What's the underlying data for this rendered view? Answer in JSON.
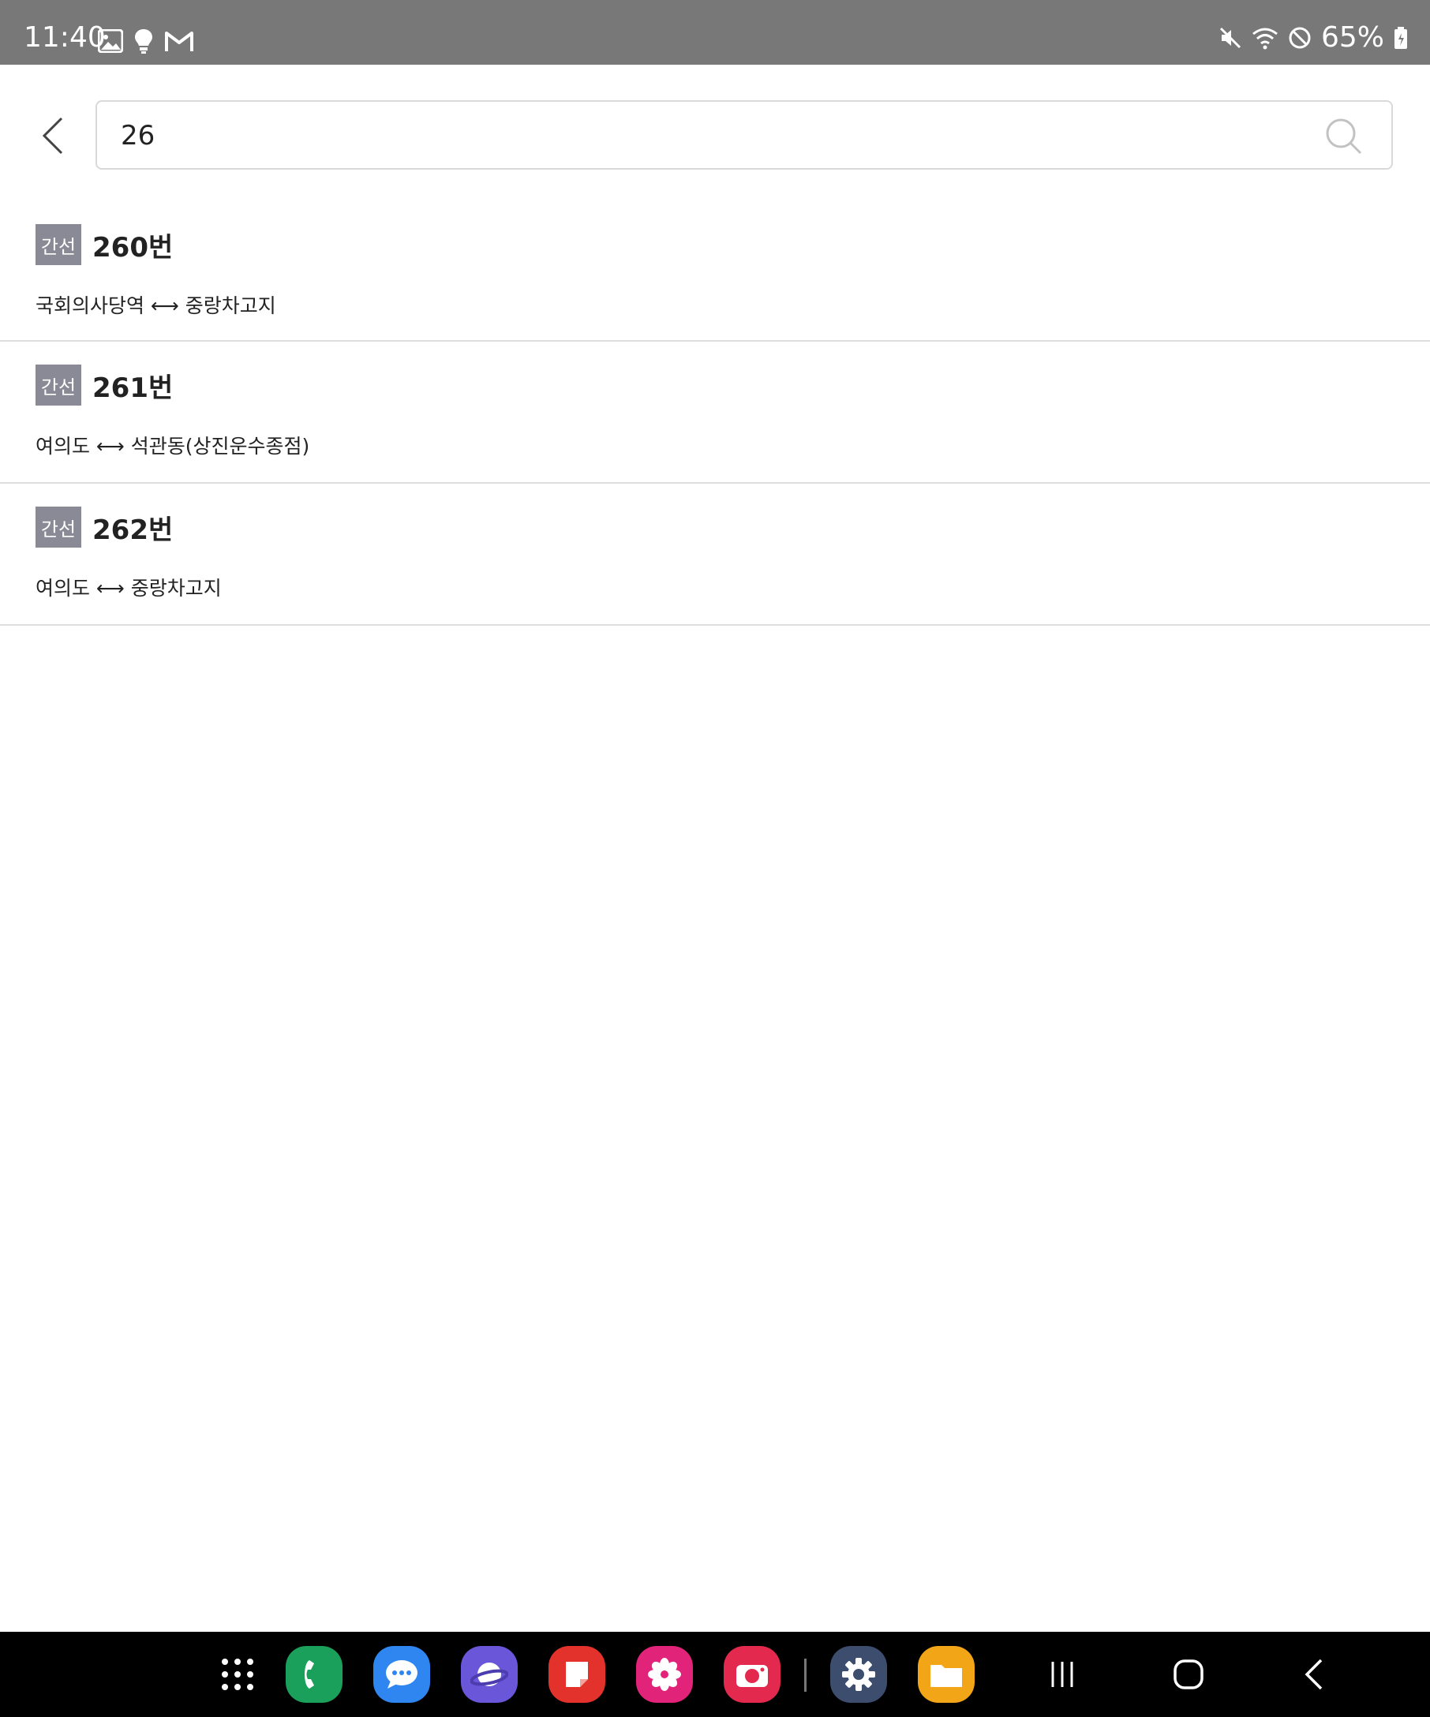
{
  "status_bar": {
    "time": "11:40",
    "battery": "65%",
    "left_icons": [
      "gallery-icon",
      "bulb-icon",
      "gmail-icon"
    ],
    "right_icons": [
      "mute-icon",
      "wifi-icon",
      "dnd-icon",
      "battery-icon"
    ]
  },
  "search": {
    "value": "26",
    "placeholder": ""
  },
  "results": [
    {
      "badge": "간선",
      "number": "260번",
      "path": "국회의사당역 ⟷ 중랑차고지"
    },
    {
      "badge": "간선",
      "number": "261번",
      "path": "여의도 ⟷ 석관동(상진운수종점)"
    },
    {
      "badge": "간선",
      "number": "262번",
      "path": "여의도 ⟷ 중랑차고지"
    }
  ],
  "colors": {
    "status_bar_bg": "#787878",
    "badge_bg": "#8a8a96",
    "caret": "#0a8a6a",
    "nav_bg": "#000000"
  },
  "dock": [
    "apps-grid-icon",
    "phone-icon",
    "messages-icon",
    "internet-icon",
    "notes-icon",
    "gallery-app-icon",
    "camera-icon",
    "settings-icon",
    "files-icon"
  ],
  "nav": [
    "recents-icon",
    "home-icon",
    "back-icon"
  ]
}
